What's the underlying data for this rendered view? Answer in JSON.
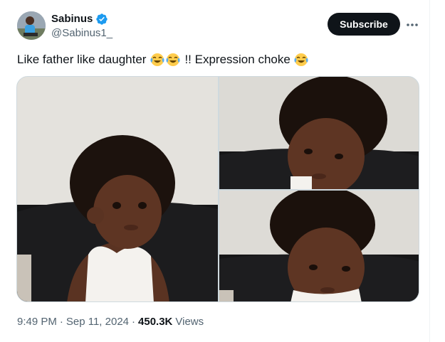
{
  "author": {
    "display_name": "Sabinus",
    "handle": "@Sabinus1_",
    "verified": true,
    "avatar": "profile-photo"
  },
  "actions": {
    "subscribe_label": "Subscribe",
    "more_icon": "more-horizontal-icon"
  },
  "tweet": {
    "text_part1": "Like father like daughter",
    "text_part2": "!! Expression choke",
    "emoji": "face-with-tears-of-joy"
  },
  "media": {
    "count": 3,
    "layout": "one-left-two-right"
  },
  "meta": {
    "time": "9:49 PM",
    "separator": "·",
    "date": "Sep 11, 2024",
    "views_count": "450.3K",
    "views_label": "Views"
  },
  "colors": {
    "text_primary": "#0f1419",
    "text_secondary": "#536471",
    "verified_blue": "#1d9bf0",
    "subscribe_bg": "#0f1419",
    "border": "#cfd9de"
  }
}
